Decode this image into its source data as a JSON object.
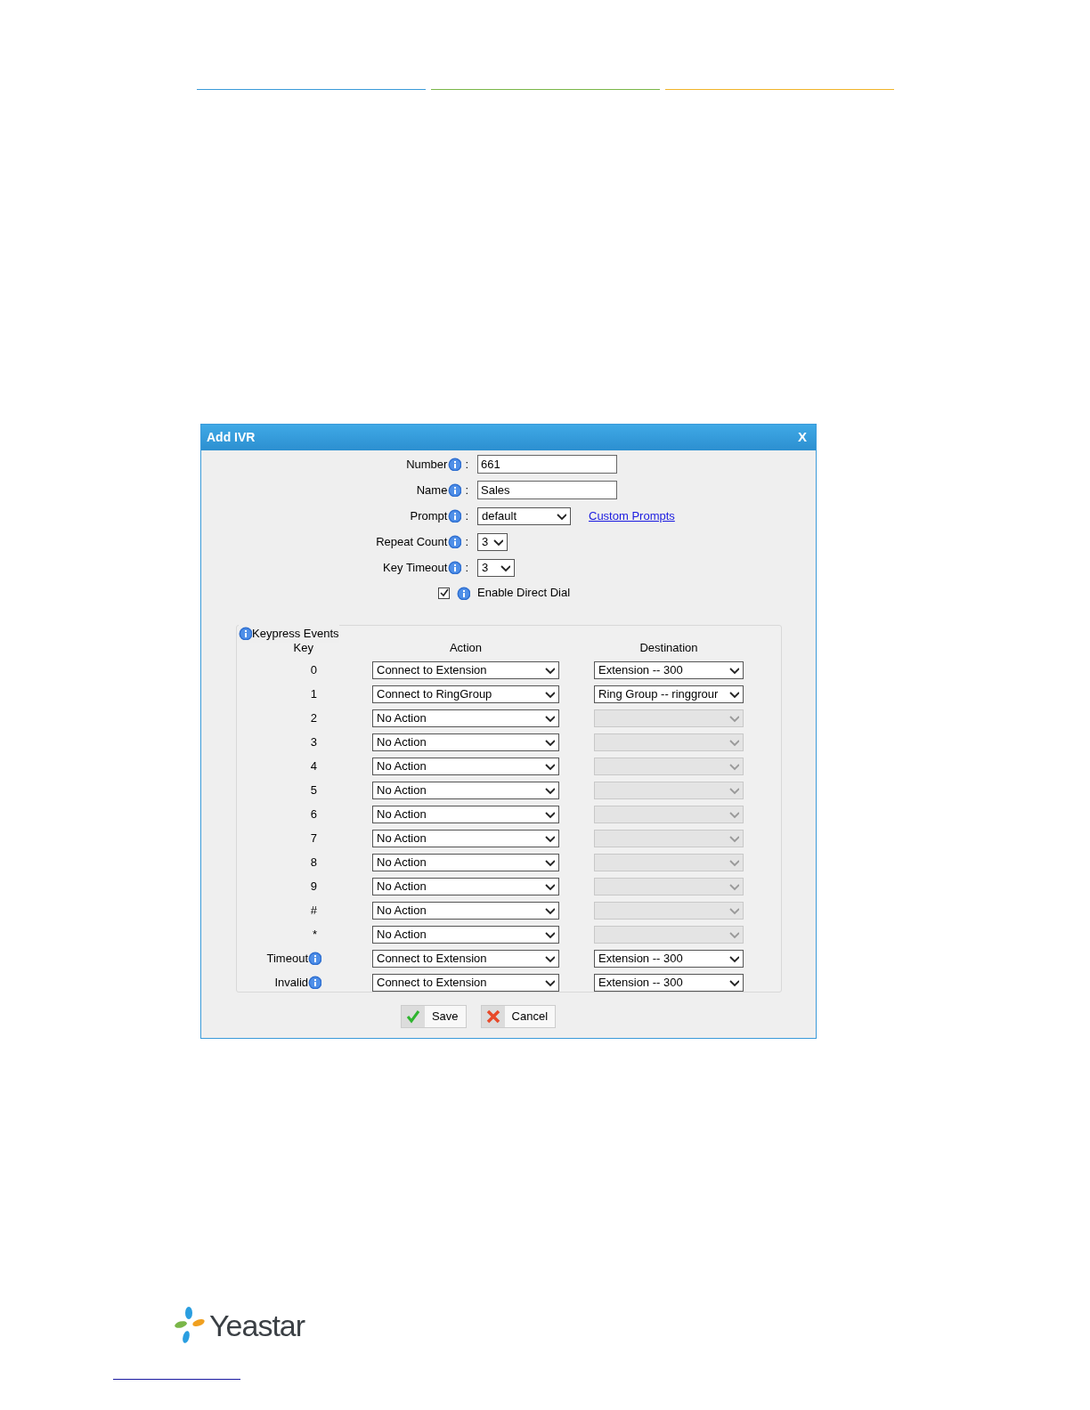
{
  "header_rules": [
    {
      "color": "#3a9ad9"
    },
    {
      "color": "#7ab648"
    },
    {
      "color": "#f0b429"
    }
  ],
  "dialog": {
    "title": "Add IVR",
    "close": "X",
    "label_separator": ":",
    "fields": [
      {
        "kind": "text",
        "label": "Number",
        "value": "661"
      },
      {
        "kind": "text",
        "label": "Name",
        "value": "Sales"
      },
      {
        "kind": "wide_select",
        "label": "Prompt",
        "value": "default",
        "link": "Custom Prompts"
      },
      {
        "kind": "narrow_select",
        "label": "Repeat Count",
        "value": "3"
      },
      {
        "kind": "narrow_select",
        "label": "Key Timeout",
        "value": "3"
      }
    ],
    "direct_dial": {
      "label": "Enable Direct Dial",
      "checked": true
    },
    "keypress": {
      "title": "Keypress Events",
      "columns": [
        "Key",
        "Action",
        "Destination"
      ],
      "rows": [
        {
          "key": "0",
          "info": false,
          "action": "Connect to Extension",
          "destination": "Extension -- 300",
          "disabled": false
        },
        {
          "key": "1",
          "info": false,
          "action": "Connect to RingGroup",
          "destination": "Ring Group -- ringgrour",
          "disabled": false
        },
        {
          "key": "2",
          "info": false,
          "action": "No Action",
          "disabled": true
        },
        {
          "key": "3",
          "info": false,
          "action": "No Action",
          "disabled": true
        },
        {
          "key": "4",
          "info": false,
          "action": "No Action",
          "disabled": true
        },
        {
          "key": "5",
          "info": false,
          "action": "No Action",
          "disabled": true
        },
        {
          "key": "6",
          "info": false,
          "action": "No Action",
          "disabled": true
        },
        {
          "key": "7",
          "info": false,
          "action": "No Action",
          "disabled": true
        },
        {
          "key": "8",
          "info": false,
          "action": "No Action",
          "disabled": true
        },
        {
          "key": "9",
          "info": false,
          "action": "No Action",
          "disabled": true
        },
        {
          "key": "#",
          "info": false,
          "action": "No Action",
          "disabled": true
        },
        {
          "key": "*",
          "info": false,
          "action": "No Action",
          "disabled": true
        },
        {
          "key": "Timeout",
          "info": true,
          "action": "Connect to Extension",
          "destination": "Extension -- 300",
          "disabled": false
        },
        {
          "key": "Invalid",
          "info": true,
          "action": "Connect to Extension",
          "destination": "Extension -- 300",
          "disabled": false
        }
      ]
    },
    "buttons": [
      {
        "kind": "save",
        "label": "Save"
      },
      {
        "kind": "cancel",
        "label": "Cancel"
      }
    ]
  },
  "logo": {
    "text": "Yeastar"
  }
}
